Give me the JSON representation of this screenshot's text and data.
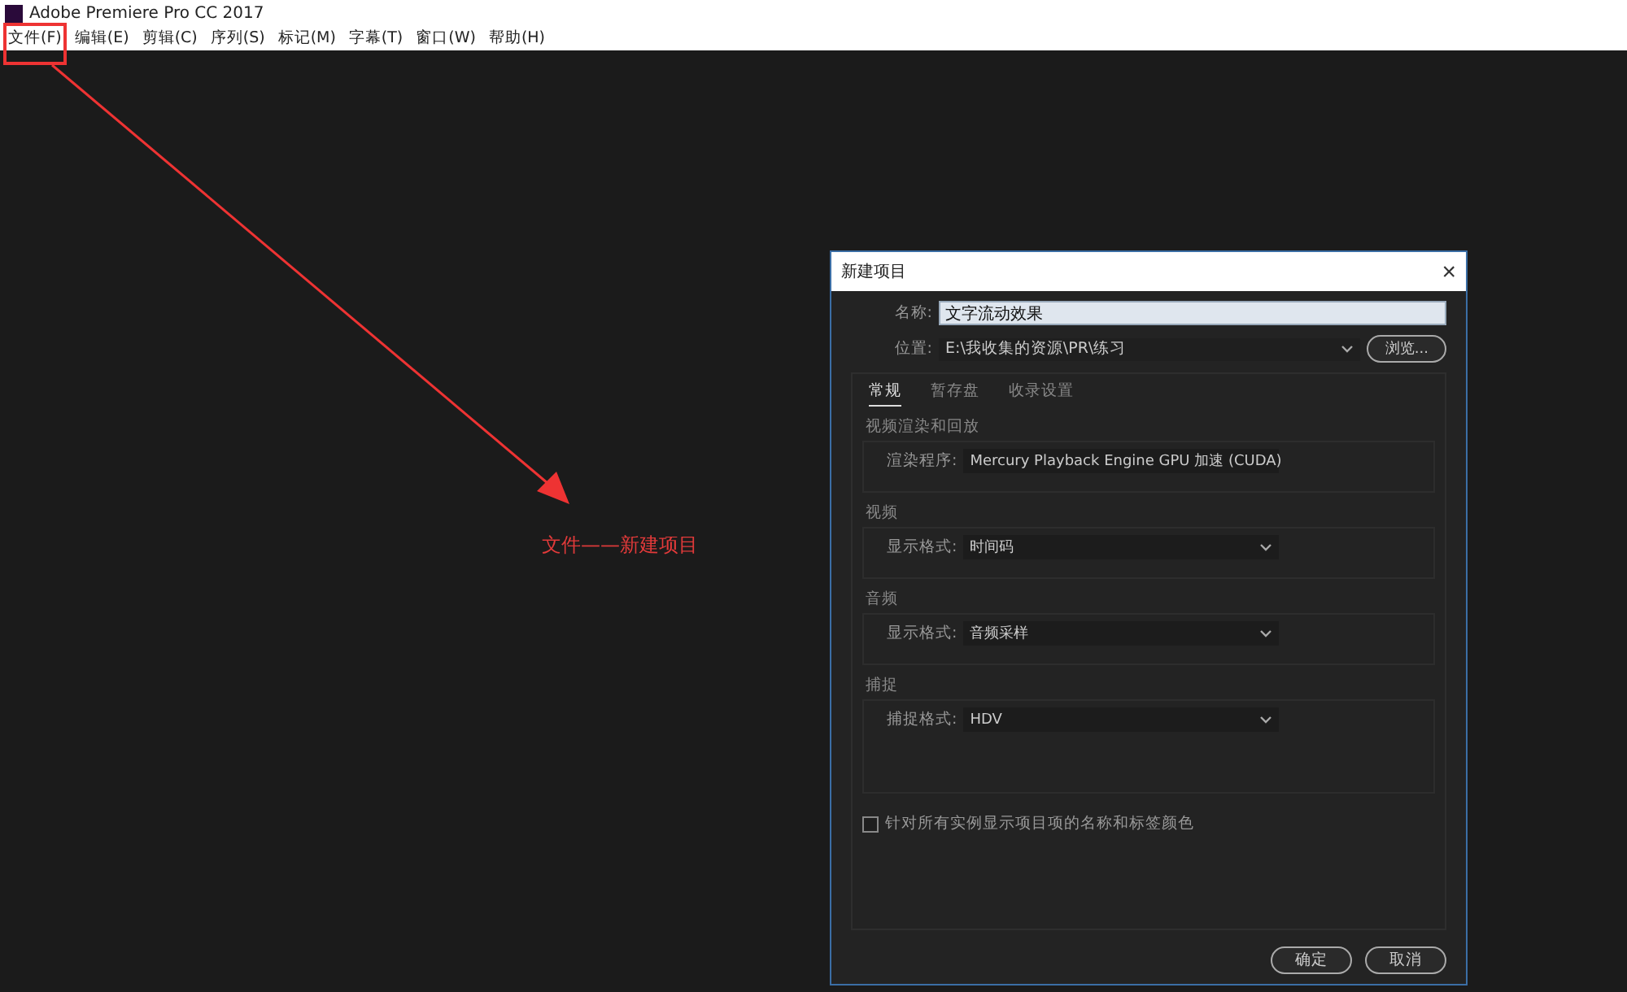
{
  "window": {
    "title": "Adobe Premiere Pro CC 2017"
  },
  "menu": [
    {
      "label": "文件(F)",
      "highlighted": true
    },
    {
      "label": "编辑(E)",
      "highlighted": false
    },
    {
      "label": "剪辑(C)",
      "highlighted": false
    },
    {
      "label": "序列(S)",
      "highlighted": false
    },
    {
      "label": "标记(M)",
      "highlighted": false
    },
    {
      "label": "字幕(T)",
      "highlighted": false
    },
    {
      "label": "窗口(W)",
      "highlighted": false
    },
    {
      "label": "帮助(H)",
      "highlighted": false
    }
  ],
  "annotation": {
    "text": "文件——新建项目"
  },
  "dialog": {
    "title": "新建项目",
    "close": "×",
    "name_label": "名称:",
    "name_value": "文字流动效果",
    "location_label": "位置:",
    "location_value": "E:\\我收集的资源\\PR\\练习",
    "browse": "浏览...",
    "tabs": [
      {
        "label": "常规",
        "selected": true
      },
      {
        "label": "暂存盘",
        "selected": false
      },
      {
        "label": "收录设置",
        "selected": false
      }
    ],
    "sections": [
      {
        "title": "视频渲染和回放",
        "label": "渲染程序:",
        "value": "Mercury Playback Engine GPU 加速 (CUDA)",
        "kind": "short"
      },
      {
        "title": "视频",
        "label": "显示格式:",
        "value": "时间码",
        "kind": "short"
      },
      {
        "title": "音频",
        "label": "显示格式:",
        "value": "音频采样",
        "kind": "short"
      },
      {
        "title": "捕捉",
        "label": "捕捉格式:",
        "value": "HDV",
        "kind": "tall"
      }
    ],
    "checkbox": {
      "label": "针对所有实例显示项目项的名称和标签颜色",
      "checked": false
    },
    "buttons": [
      "确定",
      "取消"
    ]
  }
}
